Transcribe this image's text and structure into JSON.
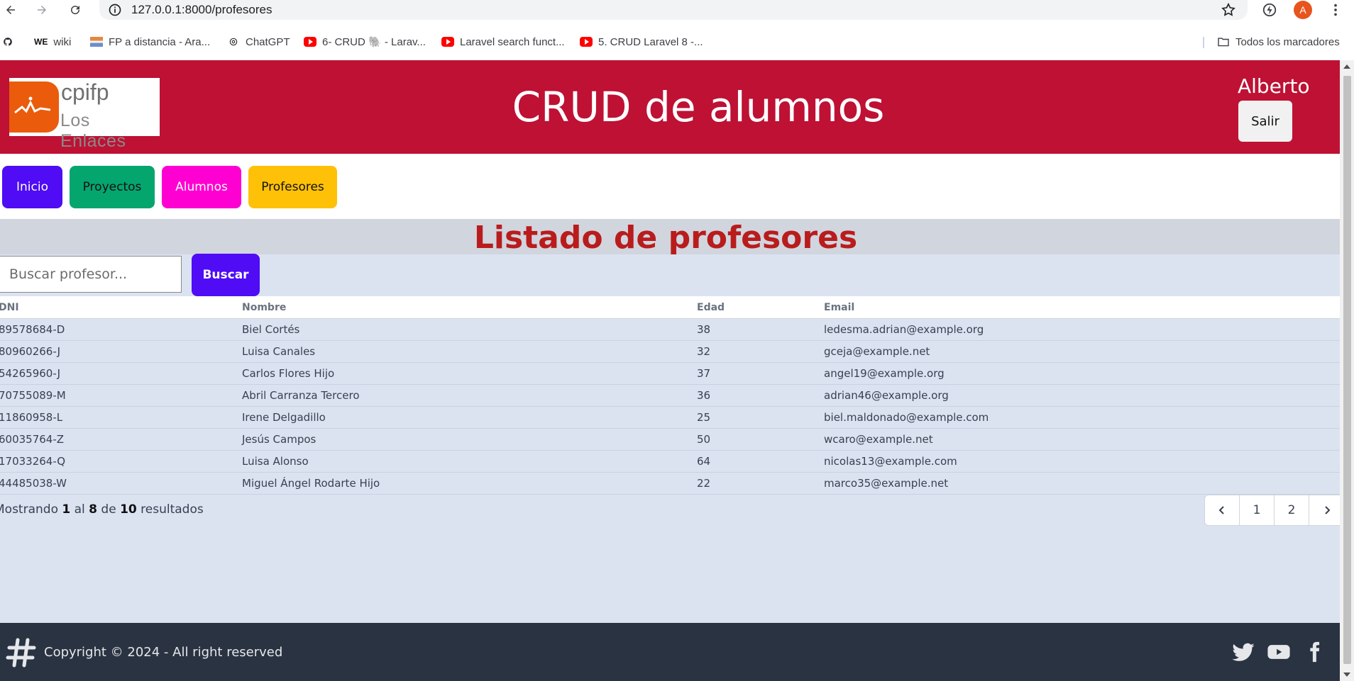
{
  "browser": {
    "url": "127.0.0.1:8000/profesores",
    "avatar_letter": "A",
    "bookmarks": [
      {
        "label": "",
        "icon": "github-icon"
      },
      {
        "label": "wiki",
        "icon": "we-icon"
      },
      {
        "label": "FP a distancia - Ara...",
        "icon": "fp-icon"
      },
      {
        "label": "ChatGPT",
        "icon": "openai-icon"
      },
      {
        "label": "6- CRUD 🐘 - Larav...",
        "icon": "youtube-icon"
      },
      {
        "label": "Laravel search funct...",
        "icon": "youtube-icon"
      },
      {
        "label": "5. CRUD Laravel 8 -...",
        "icon": "youtube-icon"
      }
    ],
    "all_bookmarks": "Todos los marcadores"
  },
  "header": {
    "logo_top": "cpifp",
    "logo_bottom": "Los Enlaces",
    "title": "CRUD de alumnos",
    "user": "Alberto",
    "logout": "Salir"
  },
  "menu": {
    "items": [
      {
        "label": "Inicio",
        "color": "#4f0cf5",
        "text_color": "#ffffff"
      },
      {
        "label": "Proyectos",
        "color": "#05a56e",
        "text_color": "#111111"
      },
      {
        "label": "Alumnos",
        "color": "#ff00d2",
        "text_color": "#ffffff"
      },
      {
        "label": "Profesores",
        "color": "#ffc107",
        "text_color": "#111111"
      }
    ]
  },
  "page": {
    "title": "Listado de profesores",
    "search_placeholder": "Buscar profesor...",
    "search_button": "Buscar"
  },
  "table": {
    "columns": [
      "DNI",
      "Nombre",
      "Edad",
      "Email"
    ],
    "rows": [
      [
        "89578684-D",
        "Biel Cortés",
        "38",
        "ledesma.adrian@example.org"
      ],
      [
        "80960266-J",
        "Luisa Canales",
        "32",
        "gceja@example.net"
      ],
      [
        "54265960-J",
        "Carlos Flores Hijo",
        "37",
        "angel19@example.org"
      ],
      [
        "70755089-M",
        "Abril Carranza Tercero",
        "36",
        "adrian46@example.org"
      ],
      [
        "11860958-L",
        "Irene Delgadillo",
        "25",
        "biel.maldonado@example.com"
      ],
      [
        "60035764-Z",
        "Jesús Campos",
        "50",
        "wcaro@example.net"
      ],
      [
        "17033264-Q",
        "Luisa Alonso",
        "64",
        "nicolas13@example.com"
      ],
      [
        "44485038-W",
        "Miguel Ángel Rodarte Hijo",
        "22",
        "marco35@example.net"
      ]
    ]
  },
  "pagination": {
    "prefix": "Mostrando",
    "from": "1",
    "word_al": "al",
    "to": "8",
    "word_de": "de",
    "total": "10",
    "suffix": "resultados",
    "pages": [
      "1",
      "2"
    ]
  },
  "footer": {
    "text": "Copyright © 2024 - All right reserved",
    "social": [
      "twitter-icon",
      "youtube-icon",
      "facebook-icon"
    ]
  },
  "colors": {
    "header": "#be1134",
    "title": "#b91c1c",
    "footer": "#2a3341",
    "page_bg": "#dbe3f1"
  }
}
